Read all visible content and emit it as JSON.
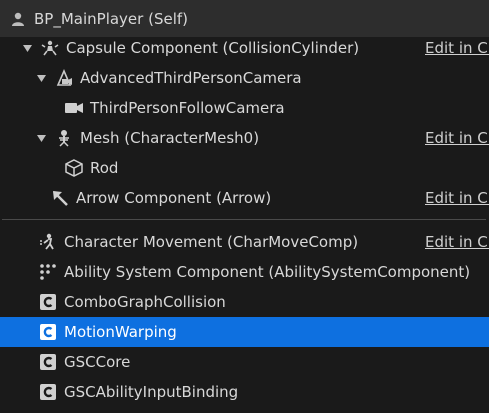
{
  "root": {
    "label": "BP_MainPlayer (Self)",
    "icon": "person-icon"
  },
  "rows": [
    {
      "label": "Capsule Component (CollisionCylinder)",
      "icon": "capsule-icon",
      "edit": "Edit in C++"
    },
    {
      "label": "AdvancedThirdPersonCamera",
      "icon": "camera-rig-icon"
    },
    {
      "label": "ThirdPersonFollowCamera",
      "icon": "camera-icon"
    },
    {
      "label": "Mesh (CharacterMesh0)",
      "icon": "skeleton-icon",
      "edit": "Edit in C++"
    },
    {
      "label": "Rod",
      "icon": "static-mesh-icon"
    },
    {
      "label": "Arrow Component (Arrow)",
      "icon": "arrow-icon",
      "edit": "Edit in C++"
    },
    {
      "label": "Character Movement (CharMoveComp)",
      "icon": "character-movement-icon",
      "edit": "Edit in C++"
    },
    {
      "label": "Ability System Component (AbilitySystemComponent)",
      "icon": "dots-icon"
    },
    {
      "label": "ComboGraphCollision",
      "icon": "component-icon"
    },
    {
      "label": "MotionWarping",
      "icon": "component-icon"
    },
    {
      "label": "GSCCore",
      "icon": "component-icon"
    },
    {
      "label": "GSCAbilityInputBinding",
      "icon": "component-icon"
    }
  ],
  "colors": {
    "background": "#1a1a1a",
    "root_bg": "#2d2d2d",
    "selected": "#0e70e0",
    "text": "#d8d8d8"
  }
}
